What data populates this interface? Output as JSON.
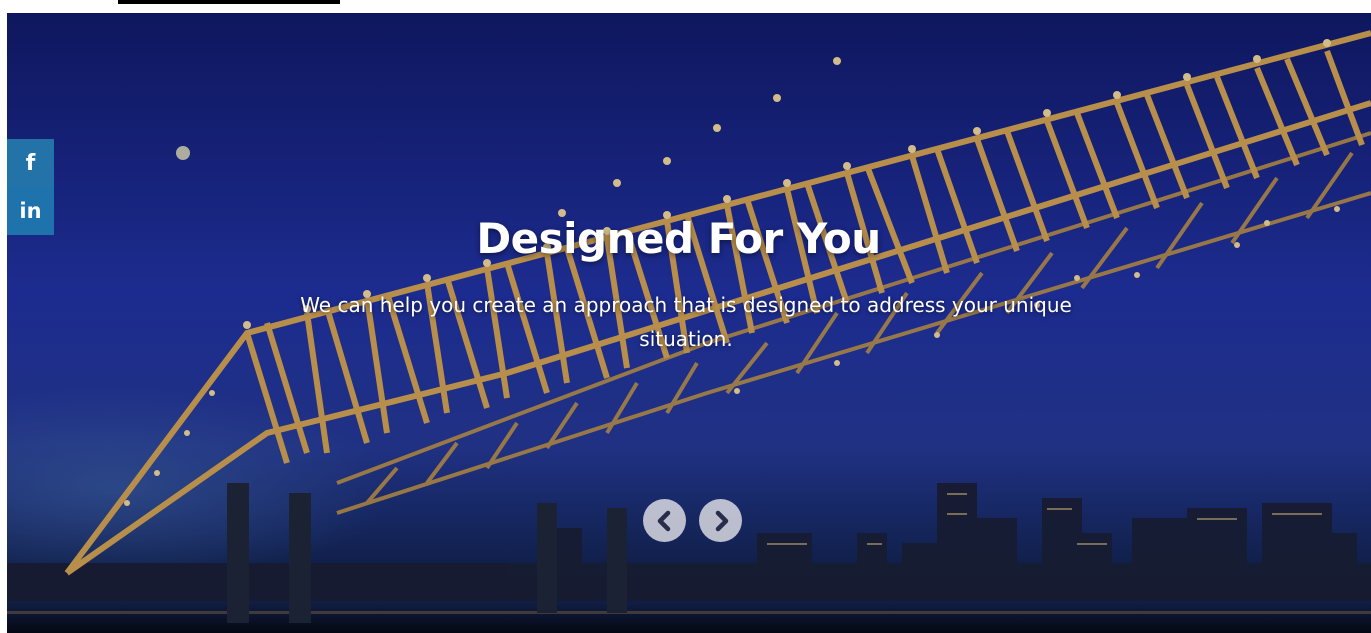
{
  "hero": {
    "title": "Designed For You",
    "subtitle": "We can help you create an approach that is designed to address your unique situation.",
    "background_description_colors": {
      "sky": "#1f2fa0",
      "bridge_lights": "#f3c36b",
      "water": "#0a1222"
    }
  },
  "social": {
    "items": [
      {
        "icon": "facebook-icon",
        "glyph": "f",
        "color": "#2372a8"
      },
      {
        "icon": "linkedin-icon",
        "glyph": "in",
        "color": "#1f73ad"
      }
    ]
  },
  "slider": {
    "prev_icon": "chevron-left-icon",
    "next_icon": "chevron-right-icon",
    "button_color": "#e1e1e6",
    "arrow_color": "#2a2d4a"
  }
}
